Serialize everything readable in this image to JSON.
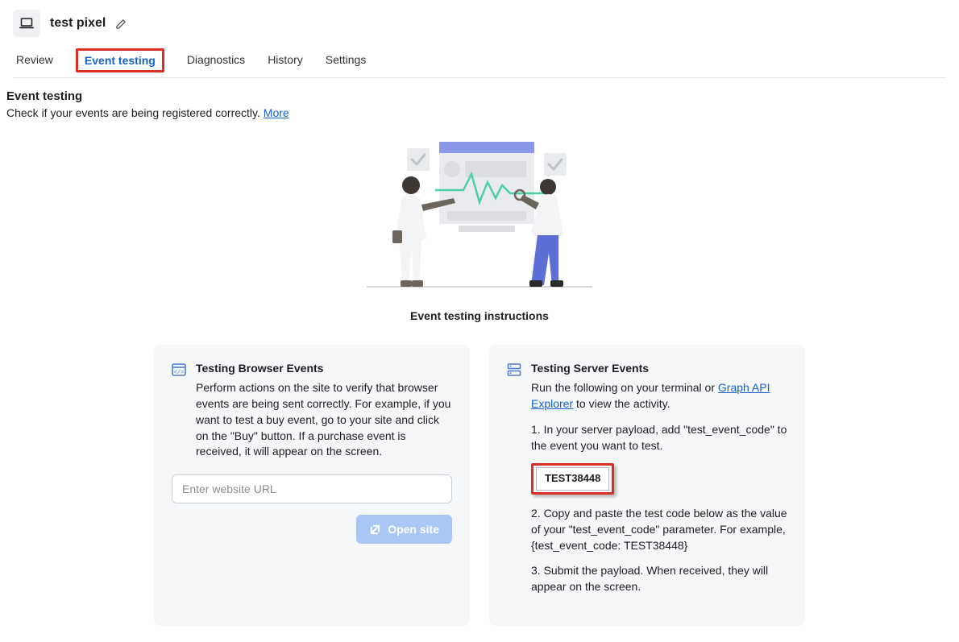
{
  "header": {
    "title": "test pixel"
  },
  "tabs": [
    {
      "label": "Review",
      "active": false
    },
    {
      "label": "Event testing",
      "active": true
    },
    {
      "label": "Diagnostics",
      "active": false
    },
    {
      "label": "History",
      "active": false
    },
    {
      "label": "Settings",
      "active": false
    }
  ],
  "section": {
    "title": "Event testing",
    "subtitle_prefix": "Check if your events are being registered correctly. ",
    "subtitle_link": "More"
  },
  "illustration": {
    "caption": "Event testing instructions"
  },
  "browser_card": {
    "title": "Testing Browser Events",
    "body": "Perform actions on the site to verify that browser events are being sent correctly. For example, if you want to test a buy event, go to your site and click on the \"Buy\" button. If a purchase event is received, it will appear on the screen.",
    "input_placeholder": "Enter website URL",
    "button_label": "Open site"
  },
  "server_card": {
    "title": "Testing Server Events",
    "intro_prefix": "Run the following on your terminal or ",
    "intro_link": "Graph API Explorer",
    "intro_suffix": " to view the activity.",
    "step1": "1. In your server payload, add \"test_event_code\" to the event you want to test.",
    "test_code": "TEST38448",
    "step2": "2. Copy and paste the test code below as the value of your \"test_event_code\" parameter. For example, {test_event_code: TEST38448}",
    "step3": "3. Submit the payload. When received, they will appear on the screen."
  }
}
